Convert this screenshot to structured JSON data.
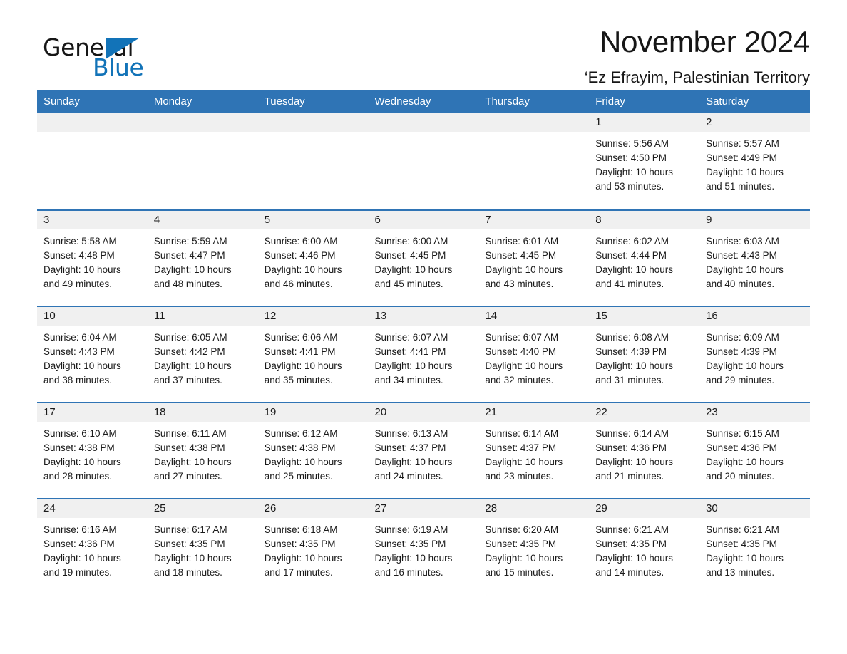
{
  "brand": {
    "name_part1": "General",
    "name_part2": "Blue",
    "triangle_color": "#1273b8"
  },
  "header": {
    "month_title": "November 2024",
    "location": "‘Ez Efrayim, Palestinian Territory"
  },
  "theme": {
    "header_blue": "#2f74b5",
    "band_gray": "#f0f0f0",
    "text": "#1a1a1a"
  },
  "calendar": {
    "weekday_headers": [
      "Sunday",
      "Monday",
      "Tuesday",
      "Wednesday",
      "Thursday",
      "Friday",
      "Saturday"
    ],
    "weeks": [
      [
        {
          "day": "",
          "lines": []
        },
        {
          "day": "",
          "lines": []
        },
        {
          "day": "",
          "lines": []
        },
        {
          "day": "",
          "lines": []
        },
        {
          "day": "",
          "lines": []
        },
        {
          "day": "1",
          "lines": [
            "Sunrise: 5:56 AM",
            "Sunset: 4:50 PM",
            "Daylight: 10 hours",
            "and 53 minutes."
          ]
        },
        {
          "day": "2",
          "lines": [
            "Sunrise: 5:57 AM",
            "Sunset: 4:49 PM",
            "Daylight: 10 hours",
            "and 51 minutes."
          ]
        }
      ],
      [
        {
          "day": "3",
          "lines": [
            "Sunrise: 5:58 AM",
            "Sunset: 4:48 PM",
            "Daylight: 10 hours",
            "and 49 minutes."
          ]
        },
        {
          "day": "4",
          "lines": [
            "Sunrise: 5:59 AM",
            "Sunset: 4:47 PM",
            "Daylight: 10 hours",
            "and 48 minutes."
          ]
        },
        {
          "day": "5",
          "lines": [
            "Sunrise: 6:00 AM",
            "Sunset: 4:46 PM",
            "Daylight: 10 hours",
            "and 46 minutes."
          ]
        },
        {
          "day": "6",
          "lines": [
            "Sunrise: 6:00 AM",
            "Sunset: 4:45 PM",
            "Daylight: 10 hours",
            "and 45 minutes."
          ]
        },
        {
          "day": "7",
          "lines": [
            "Sunrise: 6:01 AM",
            "Sunset: 4:45 PM",
            "Daylight: 10 hours",
            "and 43 minutes."
          ]
        },
        {
          "day": "8",
          "lines": [
            "Sunrise: 6:02 AM",
            "Sunset: 4:44 PM",
            "Daylight: 10 hours",
            "and 41 minutes."
          ]
        },
        {
          "day": "9",
          "lines": [
            "Sunrise: 6:03 AM",
            "Sunset: 4:43 PM",
            "Daylight: 10 hours",
            "and 40 minutes."
          ]
        }
      ],
      [
        {
          "day": "10",
          "lines": [
            "Sunrise: 6:04 AM",
            "Sunset: 4:43 PM",
            "Daylight: 10 hours",
            "and 38 minutes."
          ]
        },
        {
          "day": "11",
          "lines": [
            "Sunrise: 6:05 AM",
            "Sunset: 4:42 PM",
            "Daylight: 10 hours",
            "and 37 minutes."
          ]
        },
        {
          "day": "12",
          "lines": [
            "Sunrise: 6:06 AM",
            "Sunset: 4:41 PM",
            "Daylight: 10 hours",
            "and 35 minutes."
          ]
        },
        {
          "day": "13",
          "lines": [
            "Sunrise: 6:07 AM",
            "Sunset: 4:41 PM",
            "Daylight: 10 hours",
            "and 34 minutes."
          ]
        },
        {
          "day": "14",
          "lines": [
            "Sunrise: 6:07 AM",
            "Sunset: 4:40 PM",
            "Daylight: 10 hours",
            "and 32 minutes."
          ]
        },
        {
          "day": "15",
          "lines": [
            "Sunrise: 6:08 AM",
            "Sunset: 4:39 PM",
            "Daylight: 10 hours",
            "and 31 minutes."
          ]
        },
        {
          "day": "16",
          "lines": [
            "Sunrise: 6:09 AM",
            "Sunset: 4:39 PM",
            "Daylight: 10 hours",
            "and 29 minutes."
          ]
        }
      ],
      [
        {
          "day": "17",
          "lines": [
            "Sunrise: 6:10 AM",
            "Sunset: 4:38 PM",
            "Daylight: 10 hours",
            "and 28 minutes."
          ]
        },
        {
          "day": "18",
          "lines": [
            "Sunrise: 6:11 AM",
            "Sunset: 4:38 PM",
            "Daylight: 10 hours",
            "and 27 minutes."
          ]
        },
        {
          "day": "19",
          "lines": [
            "Sunrise: 6:12 AM",
            "Sunset: 4:38 PM",
            "Daylight: 10 hours",
            "and 25 minutes."
          ]
        },
        {
          "day": "20",
          "lines": [
            "Sunrise: 6:13 AM",
            "Sunset: 4:37 PM",
            "Daylight: 10 hours",
            "and 24 minutes."
          ]
        },
        {
          "day": "21",
          "lines": [
            "Sunrise: 6:14 AM",
            "Sunset: 4:37 PM",
            "Daylight: 10 hours",
            "and 23 minutes."
          ]
        },
        {
          "day": "22",
          "lines": [
            "Sunrise: 6:14 AM",
            "Sunset: 4:36 PM",
            "Daylight: 10 hours",
            "and 21 minutes."
          ]
        },
        {
          "day": "23",
          "lines": [
            "Sunrise: 6:15 AM",
            "Sunset: 4:36 PM",
            "Daylight: 10 hours",
            "and 20 minutes."
          ]
        }
      ],
      [
        {
          "day": "24",
          "lines": [
            "Sunrise: 6:16 AM",
            "Sunset: 4:36 PM",
            "Daylight: 10 hours",
            "and 19 minutes."
          ]
        },
        {
          "day": "25",
          "lines": [
            "Sunrise: 6:17 AM",
            "Sunset: 4:35 PM",
            "Daylight: 10 hours",
            "and 18 minutes."
          ]
        },
        {
          "day": "26",
          "lines": [
            "Sunrise: 6:18 AM",
            "Sunset: 4:35 PM",
            "Daylight: 10 hours",
            "and 17 minutes."
          ]
        },
        {
          "day": "27",
          "lines": [
            "Sunrise: 6:19 AM",
            "Sunset: 4:35 PM",
            "Daylight: 10 hours",
            "and 16 minutes."
          ]
        },
        {
          "day": "28",
          "lines": [
            "Sunrise: 6:20 AM",
            "Sunset: 4:35 PM",
            "Daylight: 10 hours",
            "and 15 minutes."
          ]
        },
        {
          "day": "29",
          "lines": [
            "Sunrise: 6:21 AM",
            "Sunset: 4:35 PM",
            "Daylight: 10 hours",
            "and 14 minutes."
          ]
        },
        {
          "day": "30",
          "lines": [
            "Sunrise: 6:21 AM",
            "Sunset: 4:35 PM",
            "Daylight: 10 hours",
            "and 13 minutes."
          ]
        }
      ]
    ]
  }
}
